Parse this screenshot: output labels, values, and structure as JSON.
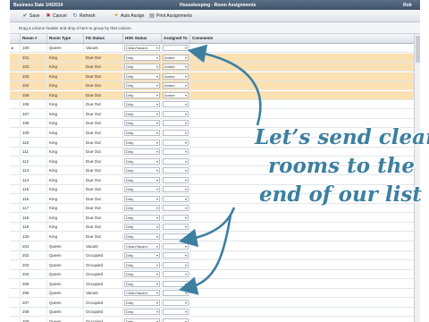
{
  "titlebar": {
    "business_date": "Business Date   1/4/2014",
    "title": "Housekeeping - Room Assignments",
    "user": "Rob"
  },
  "toolbar": {
    "save": "Save",
    "cancel": "Cancel",
    "refresh": "Refresh",
    "auto_assign": "Auto Assign",
    "print": "Print Assignments"
  },
  "groupbar": {
    "hint": "Drag a column header and drop it here to group by that column"
  },
  "columns": [
    "Room #",
    "Room Type",
    "FD Status",
    "HSK Status",
    "Assigned To",
    "Comments"
  ],
  "rows": [
    {
      "room": "100",
      "type": "Queen",
      "fd": "Vacant",
      "hsk": "Clean/Vacant",
      "assigned": "",
      "hl": false,
      "selected": true
    },
    {
      "room": "101",
      "type": "King",
      "fd": "Due Out",
      "hsk": "Dirty",
      "assigned": "Amber",
      "hl": true
    },
    {
      "room": "102",
      "type": "King",
      "fd": "Due Out",
      "hsk": "Dirty",
      "assigned": "Amber",
      "hl": true
    },
    {
      "room": "103",
      "type": "King",
      "fd": "Due Out",
      "hsk": "Dirty",
      "assigned": "Amber",
      "hl": true
    },
    {
      "room": "104",
      "type": "King",
      "fd": "Due Out",
      "hsk": "Dirty",
      "assigned": "Amber",
      "hl": true
    },
    {
      "room": "105",
      "type": "King",
      "fd": "Due Out",
      "hsk": "Dirty",
      "assigned": "Amber",
      "hl": true
    },
    {
      "room": "106",
      "type": "King",
      "fd": "Due Out",
      "hsk": "Dirty",
      "assigned": "",
      "hl": false
    },
    {
      "room": "107",
      "type": "King",
      "fd": "Due Out",
      "hsk": "Dirty",
      "assigned": "",
      "hl": false
    },
    {
      "room": "108",
      "type": "King",
      "fd": "Due Out",
      "hsk": "Dirty",
      "assigned": "",
      "hl": false
    },
    {
      "room": "109",
      "type": "King",
      "fd": "Due Out",
      "hsk": "Dirty",
      "assigned": "",
      "hl": false
    },
    {
      "room": "110",
      "type": "King",
      "fd": "Due Out",
      "hsk": "Dirty",
      "assigned": "",
      "hl": false
    },
    {
      "room": "111",
      "type": "King",
      "fd": "Due Out",
      "hsk": "Dirty",
      "assigned": "",
      "hl": false
    },
    {
      "room": "112",
      "type": "King",
      "fd": "Due Out",
      "hsk": "Dirty",
      "assigned": "",
      "hl": false
    },
    {
      "room": "113",
      "type": "King",
      "fd": "Due Out",
      "hsk": "Dirty",
      "assigned": "",
      "hl": false
    },
    {
      "room": "114",
      "type": "King",
      "fd": "Due Out",
      "hsk": "Dirty",
      "assigned": "",
      "hl": false
    },
    {
      "room": "115",
      "type": "King",
      "fd": "Due Out",
      "hsk": "Dirty",
      "assigned": "",
      "hl": false
    },
    {
      "room": "116",
      "type": "King",
      "fd": "Due Out",
      "hsk": "Dirty",
      "assigned": "",
      "hl": false
    },
    {
      "room": "117",
      "type": "King",
      "fd": "Due Out",
      "hsk": "Dirty",
      "assigned": "",
      "hl": false
    },
    {
      "room": "118",
      "type": "King",
      "fd": "Due Out",
      "hsk": "Dirty",
      "assigned": "",
      "hl": false
    },
    {
      "room": "119",
      "type": "King",
      "fd": "Due Out",
      "hsk": "Dirty",
      "assigned": "",
      "hl": false
    },
    {
      "room": "120",
      "type": "King",
      "fd": "Due Out",
      "hsk": "Dirty",
      "assigned": "",
      "hl": false
    },
    {
      "room": "201",
      "type": "Queen",
      "fd": "Vacant",
      "hsk": "Clean/Vacant",
      "assigned": "",
      "hl": false
    },
    {
      "room": "202",
      "type": "Queen",
      "fd": "Occupied",
      "hsk": "Dirty",
      "assigned": "",
      "hl": false
    },
    {
      "room": "203",
      "type": "Queen",
      "fd": "Occupied",
      "hsk": "Dirty",
      "assigned": "",
      "hl": false
    },
    {
      "room": "204",
      "type": "Queen",
      "fd": "Occupied",
      "hsk": "Dirty",
      "assigned": "",
      "hl": false
    },
    {
      "room": "205",
      "type": "Queen",
      "fd": "Occupied",
      "hsk": "Dirty",
      "assigned": "",
      "hl": false
    },
    {
      "room": "206",
      "type": "Queen",
      "fd": "Vacant",
      "hsk": "Clean/Vacant",
      "assigned": "",
      "hl": false
    },
    {
      "room": "207",
      "type": "Queen",
      "fd": "Occupied",
      "hsk": "Dirty",
      "assigned": "",
      "hl": false
    },
    {
      "room": "208",
      "type": "Queen",
      "fd": "Occupied",
      "hsk": "Dirty",
      "assigned": "",
      "hl": false
    },
    {
      "room": "209",
      "type": "Queen",
      "fd": "Occupied",
      "hsk": "Dirty",
      "assigned": "",
      "hl": false
    }
  ],
  "overlay": {
    "line1": "Let’s send clean",
    "line2": "rooms to the",
    "line3": "end of our list"
  },
  "colors": {
    "overlay_text": "#3d7fa0",
    "highlight_row": "#fbe0b2",
    "titlebar": "#4a5d74"
  }
}
